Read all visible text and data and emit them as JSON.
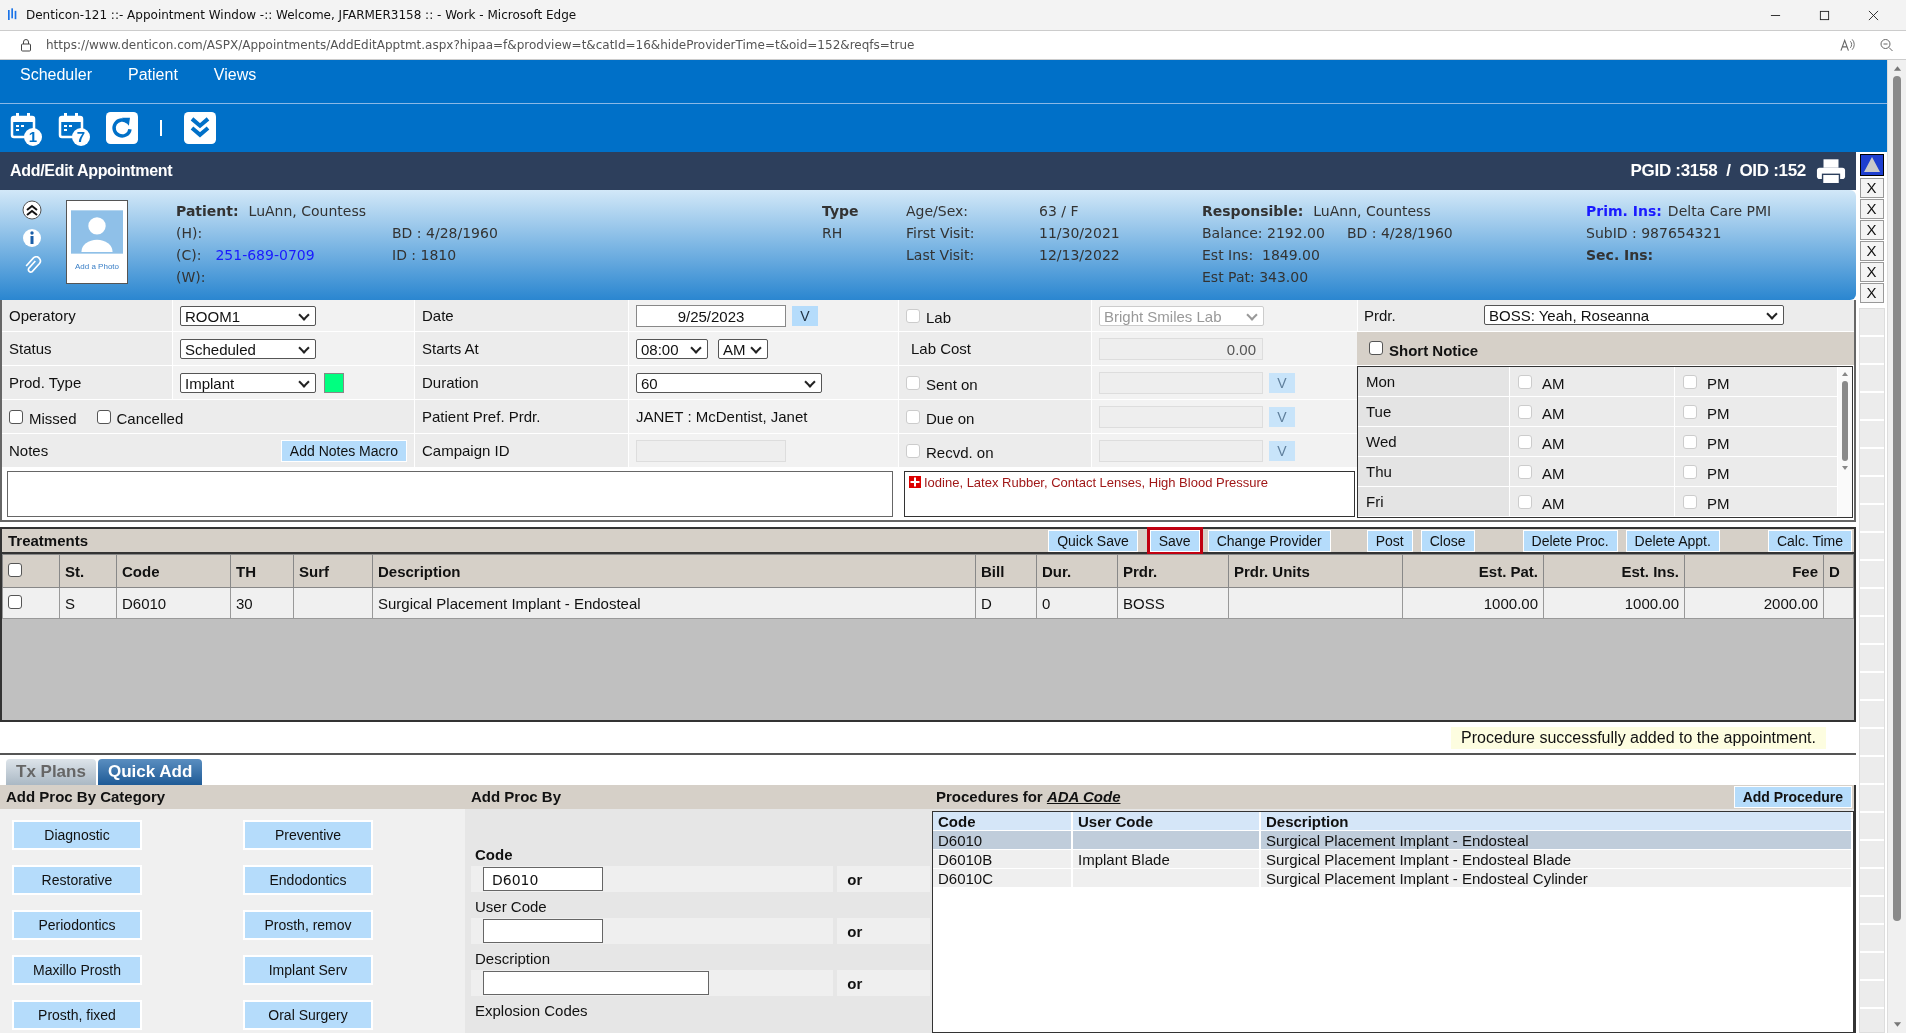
{
  "browser": {
    "title": "Denticon-121 ::- Appointment Window -:: Welcome, JFARMER3158 :: - Work - Microsoft Edge",
    "url": "https://www.denticon.com/ASPX/Appointments/AddEditApptmt.aspx?hipaa=f&prodview=t&catId=16&hideProviderTime=t&oid=152&reqfs=true"
  },
  "menu": [
    {
      "label": "Scheduler"
    },
    {
      "label": "Patient"
    },
    {
      "label": "Views"
    }
  ],
  "toolbar": [
    {
      "kind": "calendar",
      "badge": "1"
    },
    {
      "kind": "calendar",
      "badge": "7"
    },
    {
      "kind": "refresh"
    },
    {
      "kind": "separator"
    },
    {
      "kind": "expand"
    }
  ],
  "header": {
    "title": "Add/Edit Appointment",
    "ids": "PGID :3158  /  OID :152"
  },
  "side_buttons": [
    "X",
    "X",
    "X",
    "X",
    "X",
    "X"
  ],
  "patient": {
    "photo_caption": "Add a Photo",
    "name_label": "Patient:",
    "name": "LuAnn, Countess",
    "phones": [
      {
        "label": "(H):"
      },
      {
        "label": "(C):",
        "value": "251-689-0709"
      },
      {
        "label": "(W):"
      }
    ],
    "birth_date": "BD : 4/28/1960",
    "id": "ID : 1810",
    "type_label": "Type",
    "type": "RH",
    "stats": [
      {
        "label": "Age/Sex:",
        "value": "63 / F"
      },
      {
        "label": "First Visit:",
        "value": "11/30/2021"
      },
      {
        "label": "Last Visit:",
        "value": "12/13/2022"
      }
    ],
    "responsible": {
      "label": "Responsible:",
      "name": "LuAnn, Countess",
      "balance": "Balance: 2192.00",
      "birth_date": "BD : 4/28/1960",
      "est_ins": "Est Ins:  1849.00",
      "est_pat": "Est Pat: 343.00"
    },
    "insurance": {
      "primary_label": "Prim. Ins:",
      "primary": "Delta Care PMI",
      "sub_id": "SubID : 987654321",
      "secondary_label": "Sec. Ins:"
    }
  },
  "form": {
    "operatory": {
      "label": "Operatory",
      "value": "ROOM1"
    },
    "status": {
      "label": "Status",
      "value": "Scheduled"
    },
    "prod_type": {
      "label": "Prod. Type",
      "value": "Implant",
      "color": "#00ff80"
    },
    "missed": {
      "label": "Missed",
      "checked": false
    },
    "cancelled": {
      "label": "Cancelled",
      "checked": false
    },
    "notes": {
      "label": "Notes",
      "macro_button": "Add Notes Macro"
    },
    "date": {
      "label": "Date",
      "value": "9/25/2023",
      "button": "V"
    },
    "starts_at": {
      "label": "Starts At",
      "time": "08:00",
      "meridiem": "AM"
    },
    "duration": {
      "label": "Duration",
      "value": "60"
    },
    "pref_provider": {
      "label": "Patient Pref. Prdr.",
      "value": "JANET : McDentist, Janet"
    },
    "campaign": {
      "label": "Campaign ID"
    },
    "lab": {
      "label": "Lab",
      "checked": false,
      "value": "Bright Smiles Lab",
      "disabled": true
    },
    "lab_cost": {
      "label": "Lab Cost",
      "value": "0.00",
      "disabled": true
    },
    "lab_dates": [
      {
        "label": "Sent on",
        "checked": false,
        "disabled": true,
        "button": "V"
      },
      {
        "label": "Due on",
        "checked": false,
        "disabled": true,
        "button": "V"
      },
      {
        "label": "Recvd. on",
        "checked": false,
        "disabled": true,
        "button": "V"
      }
    ],
    "alerts": "Iodine, Latex Rubber, Contact Lenses, High Blood Pressure",
    "provider": {
      "label": "Prdr.",
      "value": "BOSS: Yeah, Roseanna"
    },
    "short_notice": {
      "label": "Short Notice",
      "checked": false
    },
    "days": [
      {
        "day": "Mon",
        "am_label": "AM",
        "am": false,
        "pm_label": "PM",
        "pm": false
      },
      {
        "day": "Tue",
        "am_label": "AM",
        "am": false,
        "pm_label": "PM",
        "pm": false
      },
      {
        "day": "Wed",
        "am_label": "AM",
        "am": false,
        "pm_label": "PM",
        "pm": false
      },
      {
        "day": "Thu",
        "am_label": "AM",
        "am": false,
        "pm_label": "PM",
        "pm": false
      },
      {
        "day": "Fri",
        "am_label": "AM",
        "am": false,
        "pm_label": "PM",
        "pm": false
      }
    ]
  },
  "treatments": {
    "title": "Treatments",
    "buttons": [
      {
        "label": "Quick Save",
        "focused": false
      },
      {
        "label": "Save",
        "focused": true
      },
      {
        "label": "Change Provider",
        "focused": false
      },
      {
        "label": "Post",
        "focused": false
      },
      {
        "label": "Close",
        "focused": false
      },
      {
        "label": "Delete Proc.",
        "focused": false
      },
      {
        "label": "Delete Appt.",
        "focused": false
      },
      {
        "label": "Calc. Time",
        "focused": false
      }
    ],
    "select_all": false,
    "columns": [
      "St.",
      "Code",
      "TH",
      "Surf",
      "Description",
      "Bill",
      "Dur.",
      "Prdr.",
      "Prdr. Units",
      "Est. Pat.",
      "Est. Ins.",
      "Fee",
      "D"
    ],
    "rows": [
      {
        "checked": false,
        "cells": [
          "S",
          "D6010",
          "30",
          null,
          "Surgical Placement Implant - Endosteal",
          "D",
          "0",
          "BOSS",
          null,
          "1000.00",
          "1000.00",
          "2000.00",
          null
        ]
      }
    ]
  },
  "message": "Procedure successfully added to the appointment.",
  "tabs": [
    {
      "label": "Tx Plans",
      "selected": false
    },
    {
      "label": "Quick Add",
      "selected": true
    }
  ],
  "categories": {
    "title": "Add Proc By Category",
    "buttons": [
      "Diagnostic",
      "Preventive",
      "Restorative",
      "Endodontics",
      "Periodontics",
      "Prosth, remov",
      "Maxillo Prosth",
      "Implant Serv",
      "Prosth, fixed",
      "Oral Surgery"
    ]
  },
  "add_by": {
    "title": "Add Proc By",
    "fields": [
      {
        "label": "Code",
        "emphasized": true,
        "value": "D6010",
        "or": "or"
      },
      {
        "label": "User Code",
        "emphasized": false,
        "or": "or"
      },
      {
        "label": "Description",
        "emphasized": false,
        "or": "or"
      }
    ],
    "next_label": "Explosion Codes"
  },
  "procedures": {
    "title": "Procedures for",
    "source": "ADA Code",
    "button": "Add Procedure",
    "columns": [
      "Code",
      "User Code",
      "Description"
    ],
    "rows": [
      {
        "selected": true,
        "cells": [
          "D6010",
          null,
          "Surgical Placement Implant - Endosteal"
        ]
      },
      {
        "selected": false,
        "cells": [
          "D6010B",
          "Implant Blade",
          "Surgical Placement Implant - Endosteal Blade"
        ]
      },
      {
        "selected": false,
        "cells": [
          "D6010C",
          null,
          "Surgical Placement Implant - Endosteal Cylinder"
        ]
      }
    ]
  }
}
